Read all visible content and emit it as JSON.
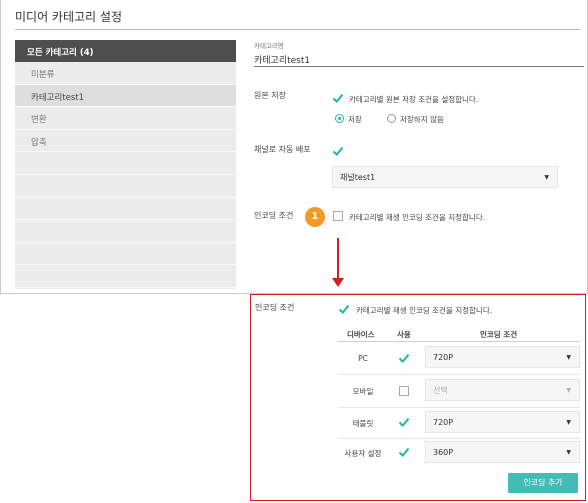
{
  "page": {
    "title": "미디어 카테고리 설정"
  },
  "sidebar": {
    "header": "모든 카테고리 (4)",
    "items": [
      "미분류",
      "카테고리test1",
      "변환",
      "압축"
    ],
    "selected_index": 1
  },
  "form": {
    "category_name_label": "카테고리명",
    "category_name_value": "카테고리test1",
    "original_storage": {
      "label": "원본 저장",
      "checkbox_text": "카테고리별 원본 저장 조건을 설정합니다.",
      "checked": true,
      "options": [
        "저장",
        "저장하지 않음"
      ],
      "selected_option": "저장"
    },
    "auto_distribute": {
      "label": "채널로 자동 배포",
      "checked": true,
      "channel_value": "채널test1"
    },
    "encoding": {
      "label": "인코딩 조건",
      "checkbox_text": "카테고리별 재생 인코딩 조건을 지정합니다.",
      "checked": false,
      "badge": "1"
    }
  },
  "detail": {
    "label": "인코딩 조건",
    "checkbox_text": "카테고리별 재생 인코딩 조건을 지정합니다.",
    "checked": true,
    "columns": [
      "디바이스",
      "사용",
      "인코딩 조건"
    ],
    "rows": [
      {
        "device": "PC",
        "enabled": true,
        "condition": "720P"
      },
      {
        "device": "모바일",
        "enabled": false,
        "condition": "선택"
      },
      {
        "device": "태블릿",
        "enabled": true,
        "condition": "720P"
      },
      {
        "device": "사용자 설정",
        "enabled": true,
        "condition": "360P"
      }
    ],
    "add_button": "인코딩 추가"
  },
  "colors": {
    "accent": "#1eb7ae",
    "button": "#44bcb5",
    "highlight": "#d42020",
    "badge": "#f29a25"
  }
}
